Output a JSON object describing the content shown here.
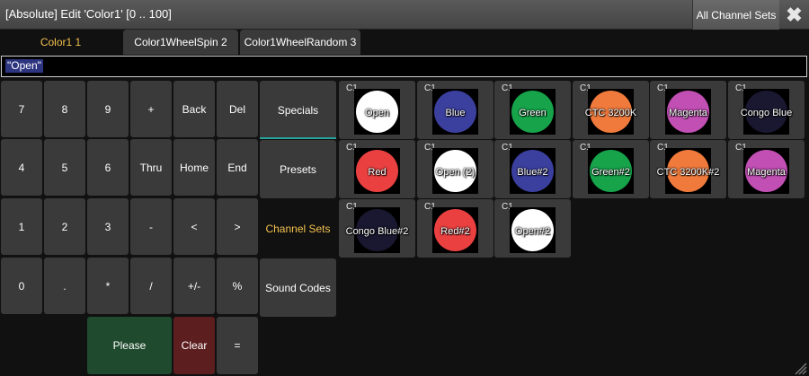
{
  "window": {
    "title": "[Absolute] Edit 'Color1' [0 .. 100]",
    "all_channel_sets_label": "All Channel Sets",
    "close_glyph": "✖"
  },
  "tabs": [
    {
      "label": "Color1 1",
      "active": true
    },
    {
      "label": "Color1WheelSpin 2",
      "active": false
    },
    {
      "label": "Color1WheelRandom 3",
      "active": false
    }
  ],
  "input": {
    "value": "\"Open\""
  },
  "keypad": {
    "row1": [
      "7",
      "8",
      "9",
      "+",
      "Back",
      "Del"
    ],
    "row2": [
      "4",
      "5",
      "6",
      "Thru",
      "Home",
      "End"
    ],
    "row3": [
      "1",
      "2",
      "3",
      "-",
      "<",
      ">"
    ],
    "row4": [
      "0",
      ".",
      "*",
      "/",
      "+/-",
      "%"
    ],
    "row5": [
      "Please",
      "Clear",
      "="
    ]
  },
  "categories": [
    {
      "label": "Specials",
      "state": "box-underlined"
    },
    {
      "label": "Presets",
      "state": "box"
    },
    {
      "label": "Channel Sets",
      "state": "active"
    },
    {
      "label": "Sound Codes",
      "state": "box"
    }
  ],
  "presets": [
    {
      "tag": "C1",
      "label": "Open",
      "color": "#ffffff"
    },
    {
      "tag": "C1",
      "label": "Blue",
      "color": "#3b3f9e"
    },
    {
      "tag": "C1",
      "label": "Green",
      "color": "#16a34a"
    },
    {
      "tag": "C1",
      "label": "CTC 3200K",
      "color": "#f07a3c"
    },
    {
      "tag": "C1",
      "label": "Magenta",
      "color": "#c14fb4"
    },
    {
      "tag": "C1",
      "label": "Congo Blue",
      "color": "#1a1830"
    },
    {
      "tag": "C1",
      "label": "Red",
      "color": "#ea4040"
    },
    {
      "tag": "C1",
      "label": "Open (2)",
      "color": "#ffffff"
    },
    {
      "tag": "C1",
      "label": "Blue#2",
      "color": "#3b3f9e"
    },
    {
      "tag": "C1",
      "label": "Green#2",
      "color": "#16a34a"
    },
    {
      "tag": "C1",
      "label": "CTC 3200K#2",
      "color": "#f07a3c"
    },
    {
      "tag": "C1",
      "label": "Magenta",
      "color": "#c14fb4"
    },
    {
      "tag": "C1",
      "label": "Congo Blue#2",
      "color": "#1a1830"
    },
    {
      "tag": "C1",
      "label": "Red#2",
      "color": "#ea4040"
    },
    {
      "tag": "C1",
      "label": "Open#2",
      "color": "#ffffff"
    }
  ],
  "colors": {
    "accent_yellow": "#f2c14e",
    "underline_teal": "#2aa39b",
    "please_green": "#1f4a2e",
    "clear_red": "#5c1e1e"
  }
}
